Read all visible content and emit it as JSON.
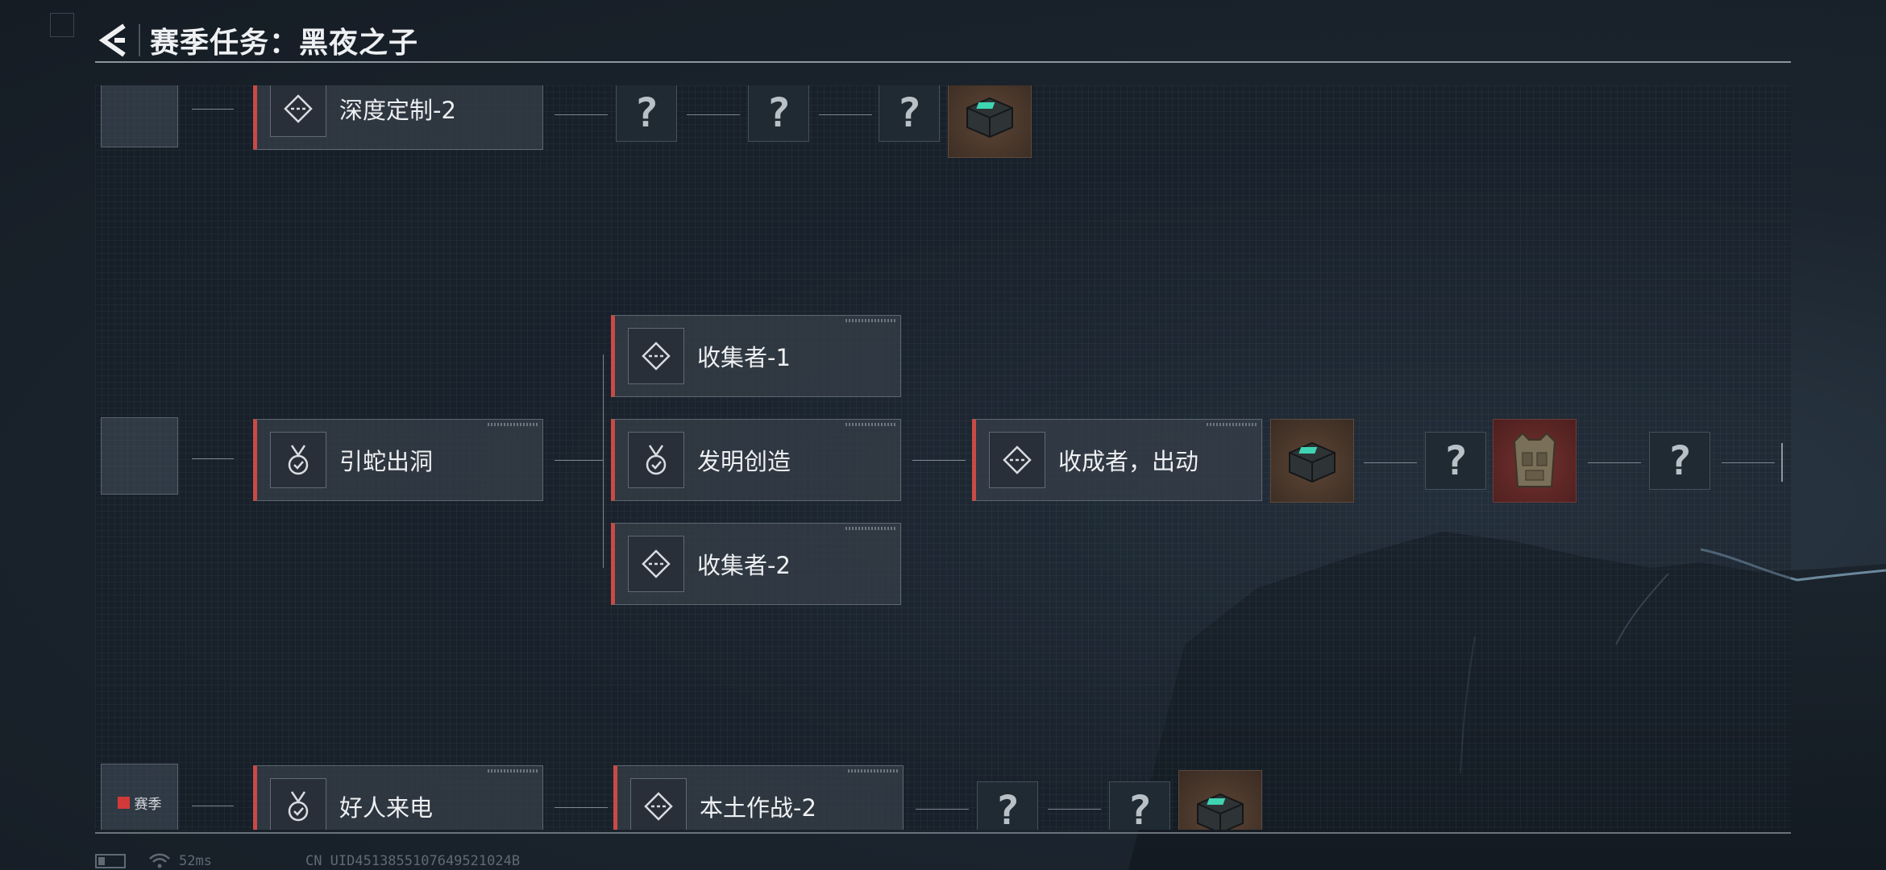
{
  "header": {
    "title": "赛季任务：黑夜之子"
  },
  "rows": {
    "top": {
      "task_label": "深度定制-2",
      "locked_mark": "?"
    },
    "middle": {
      "root_task_label": "引蛇出洞",
      "branch_tasks": [
        "收集者-1",
        "发明创造",
        "收集者-2"
      ],
      "next_task_label": "收成者，出动",
      "locked_mark": "?"
    },
    "bottom": {
      "season_tag": "赛季",
      "task_label": "好人来电",
      "next_task_label": "本土作战-2",
      "locked_mark": "?"
    }
  },
  "status": {
    "ping": "52ms",
    "uid": "CN UID4513855107649521024B"
  },
  "colors": {
    "accent_red": "#c84b45",
    "season_red": "#d23a3a",
    "task_bg": "#38404a",
    "reward_brown": "#4a3628",
    "reward_red": "#5e2726"
  },
  "icons": {
    "back": "back-arrow-icon",
    "standard_task": "route-diamond-icon",
    "medal_task": "medal-check-icon",
    "reward_case": "ammo-case-icon",
    "reward_armor": "armor-vest-icon",
    "wifi": "wifi-icon",
    "battery": "battery-icon"
  }
}
